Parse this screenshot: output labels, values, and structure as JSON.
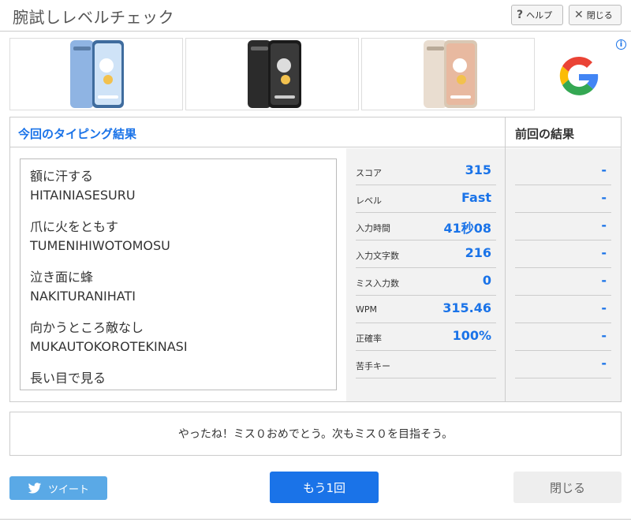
{
  "header": {
    "title": "腕試しレベルチェック",
    "help_icon": "?",
    "help_label": "ヘルプ",
    "close_icon": "✕",
    "close_label": "閉じる"
  },
  "ad": {
    "info_icon": "i",
    "close_icon": "✕",
    "phones": [
      {
        "color": "#8fb4e3"
      },
      {
        "color": "#2b2b2b"
      },
      {
        "color": "#e9ddd0"
      }
    ],
    "brand_logo": "google-g-logo"
  },
  "results": {
    "current_title": "今回のタイピング結果",
    "previous_title": "前回の結果",
    "typed_lines": [
      {
        "jp": "額に汗する",
        "romaji": "HITAINIASESURU"
      },
      {
        "jp": "爪に火をともす",
        "romaji": "TUMENIHIWOTOMOSU"
      },
      {
        "jp": "泣き面に蜂",
        "romaji": "NAKITURANIHATI"
      },
      {
        "jp": "向かうところ敵なし",
        "romaji": "MUKAUTOKOROTEKINASI"
      },
      {
        "jp": "長い目で見る",
        "romaji": ""
      }
    ],
    "stats": [
      {
        "label": "スコア",
        "value": "315",
        "previous": "-"
      },
      {
        "label": "レベル",
        "value": "Fast",
        "previous": "-"
      },
      {
        "label": "入力時間",
        "value": "41秒08",
        "previous": "-"
      },
      {
        "label": "入力文字数",
        "value": "216",
        "previous": "-"
      },
      {
        "label": "ミス入力数",
        "value": "0",
        "previous": "-"
      },
      {
        "label": "WPM",
        "value": "315.46",
        "previous": "-"
      },
      {
        "label": "正確率",
        "value": "100%",
        "previous": "-"
      },
      {
        "label": "苦手キー",
        "value": "",
        "previous": "-"
      }
    ]
  },
  "message": "やったね！ミス０おめでとう。次もミス０を目指そう。",
  "footer": {
    "tweet_label": "ツイート",
    "again_label": "もう1回",
    "close_label": "閉じる"
  },
  "colors": {
    "accent": "#1a73e8",
    "tweet": "#5aa9e6"
  }
}
